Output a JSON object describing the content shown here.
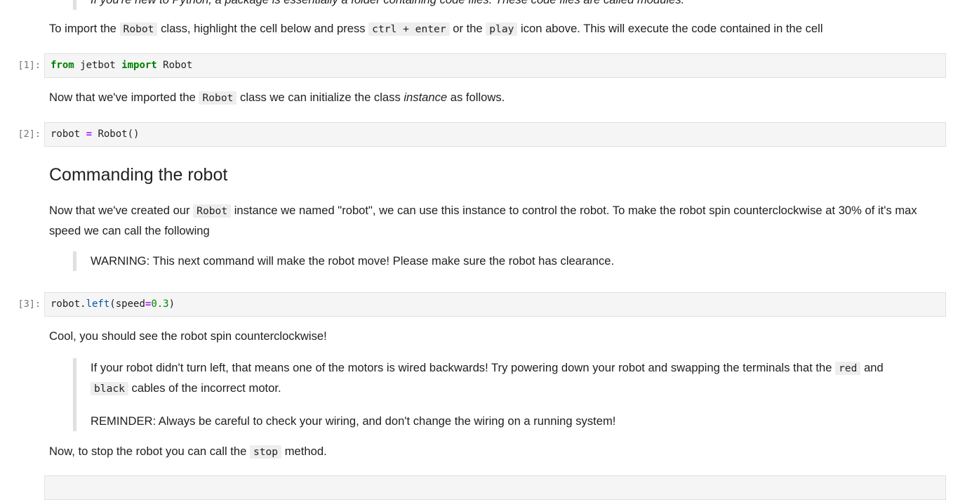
{
  "top_partial": {
    "prefix": "If you're new to Python, a ",
    "em1": "package",
    "mid": " is essentially a folder containing code files. These code files are called ",
    "em2": "modules",
    "suffix": "."
  },
  "p1": {
    "t1": "To import the ",
    "c1": "Robot",
    "t2": " class, highlight the cell below and press ",
    "c2": "ctrl + enter",
    "t3": " or the ",
    "c3": "play",
    "t4": " icon above. This will execute the code contained in the cell"
  },
  "cell1": {
    "prompt": "[1]:",
    "kw1": "from",
    "mod": " jetbot ",
    "kw2": "import",
    "name": " Robot"
  },
  "p2": {
    "t1": "Now that we've imported the ",
    "c1": "Robot",
    "t2": " class we can initialize the class ",
    "em": "instance",
    "t3": " as follows."
  },
  "cell2": {
    "prompt": "[2]:",
    "lhs": "robot ",
    "op": "=",
    "rhs": " Robot()"
  },
  "heading": "Commanding the robot",
  "p3": {
    "t1": "Now that we've created our ",
    "c1": "Robot",
    "t2": " instance we named \"robot\", we can use this instance to control the robot. To make the robot spin counterclockwise at 30% of it's max speed we can call the following"
  },
  "warning": "WARNING: This next command will make the robot move! Please make sure the robot has clearance.",
  "cell3": {
    "prompt": "[3]:",
    "obj": "robot.",
    "fn": "left",
    "open": "(speed",
    "op": "=",
    "num": "0.3",
    "close": ")"
  },
  "p4": "Cool, you should see the robot spin counterclockwise!",
  "note": {
    "t1": "If your robot didn't turn left, that means one of the motors is wired backwards! Try powering down your robot and swapping the terminals that the ",
    "c1": "red",
    "t2": " and ",
    "c2": "black",
    "t3": " cables of the incorrect motor."
  },
  "reminder": "REMINDER: Always be careful to check your wiring, and don't change the wiring on a running system!",
  "p5": {
    "t1": "Now, to stop the robot you can call the ",
    "c1": "stop",
    "t2": " method."
  }
}
